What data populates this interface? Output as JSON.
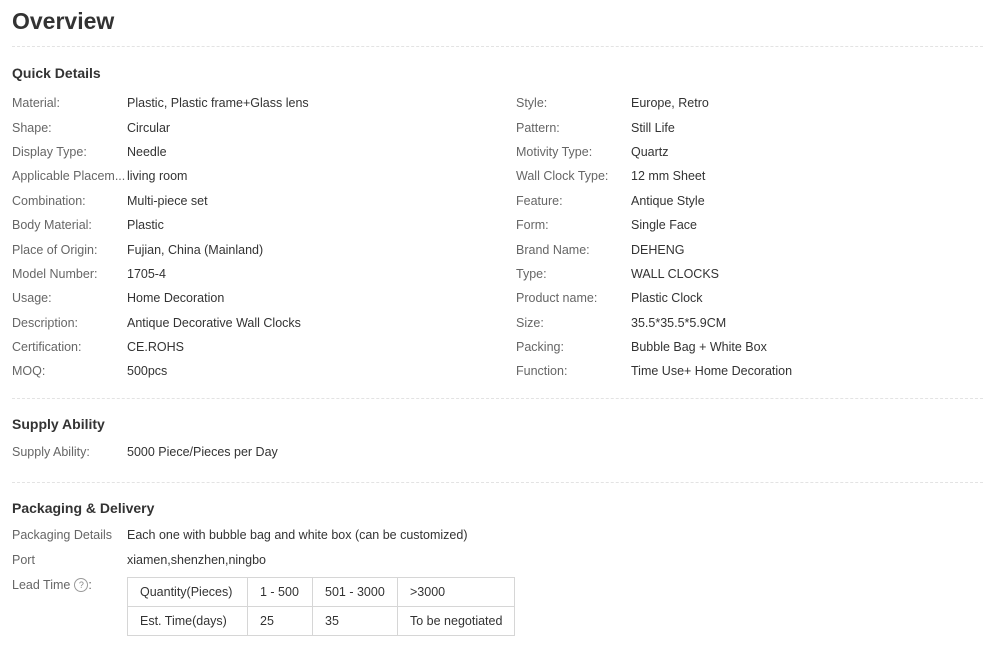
{
  "overview": {
    "title": "Overview"
  },
  "quick_details": {
    "title": "Quick Details",
    "left": [
      {
        "label": "Material:",
        "value": "Plastic, Plastic frame+Glass lens"
      },
      {
        "label": "Shape:",
        "value": "Circular"
      },
      {
        "label": "Display Type:",
        "value": "Needle"
      },
      {
        "label": "Applicable Placem...",
        "value": "living room"
      },
      {
        "label": "Combination:",
        "value": "Multi-piece set"
      },
      {
        "label": "Body Material:",
        "value": "Plastic"
      },
      {
        "label": "Place of Origin:",
        "value": "Fujian, China (Mainland)"
      },
      {
        "label": "Model Number:",
        "value": "1705-4"
      },
      {
        "label": "Usage:",
        "value": "Home Decoration"
      },
      {
        "label": "Description:",
        "value": "Antique Decorative Wall Clocks"
      },
      {
        "label": "Certification:",
        "value": "CE.ROHS"
      },
      {
        "label": "MOQ:",
        "value": "500pcs"
      }
    ],
    "right": [
      {
        "label": "Style:",
        "value": "Europe, Retro"
      },
      {
        "label": "Pattern:",
        "value": "Still Life"
      },
      {
        "label": "Motivity Type:",
        "value": "Quartz"
      },
      {
        "label": "Wall Clock Type:",
        "value": "12 mm Sheet"
      },
      {
        "label": "Feature:",
        "value": "Antique Style"
      },
      {
        "label": "Form:",
        "value": "Single Face"
      },
      {
        "label": "Brand Name:",
        "value": "DEHENG"
      },
      {
        "label": "Type:",
        "value": "WALL CLOCKS"
      },
      {
        "label": "Product name:",
        "value": "Plastic Clock"
      },
      {
        "label": "Size:",
        "value": "35.5*35.5*5.9CM"
      },
      {
        "label": "Packing:",
        "value": "Bubble Bag + White Box"
      },
      {
        "label": "Function:",
        "value": "Time Use+ Home Decoration"
      }
    ]
  },
  "supply": {
    "title": "Supply Ability",
    "label": "Supply Ability:",
    "value": "5000 Piece/Pieces per Day"
  },
  "packaging": {
    "title": "Packaging & Delivery",
    "details_label": "Packaging Details",
    "details_value": "Each one with bubble bag and white box (can be customized)",
    "port_label": "Port",
    "port_value": "xiamen,shenzhen,ningbo",
    "lead_label": "Lead Time",
    "help_glyph": "?",
    "lead_table": [
      [
        "Quantity(Pieces)",
        "1 - 500",
        "501 - 3000",
        ">3000"
      ],
      [
        "Est. Time(days)",
        "25",
        "35",
        "To be negotiated"
      ]
    ]
  }
}
